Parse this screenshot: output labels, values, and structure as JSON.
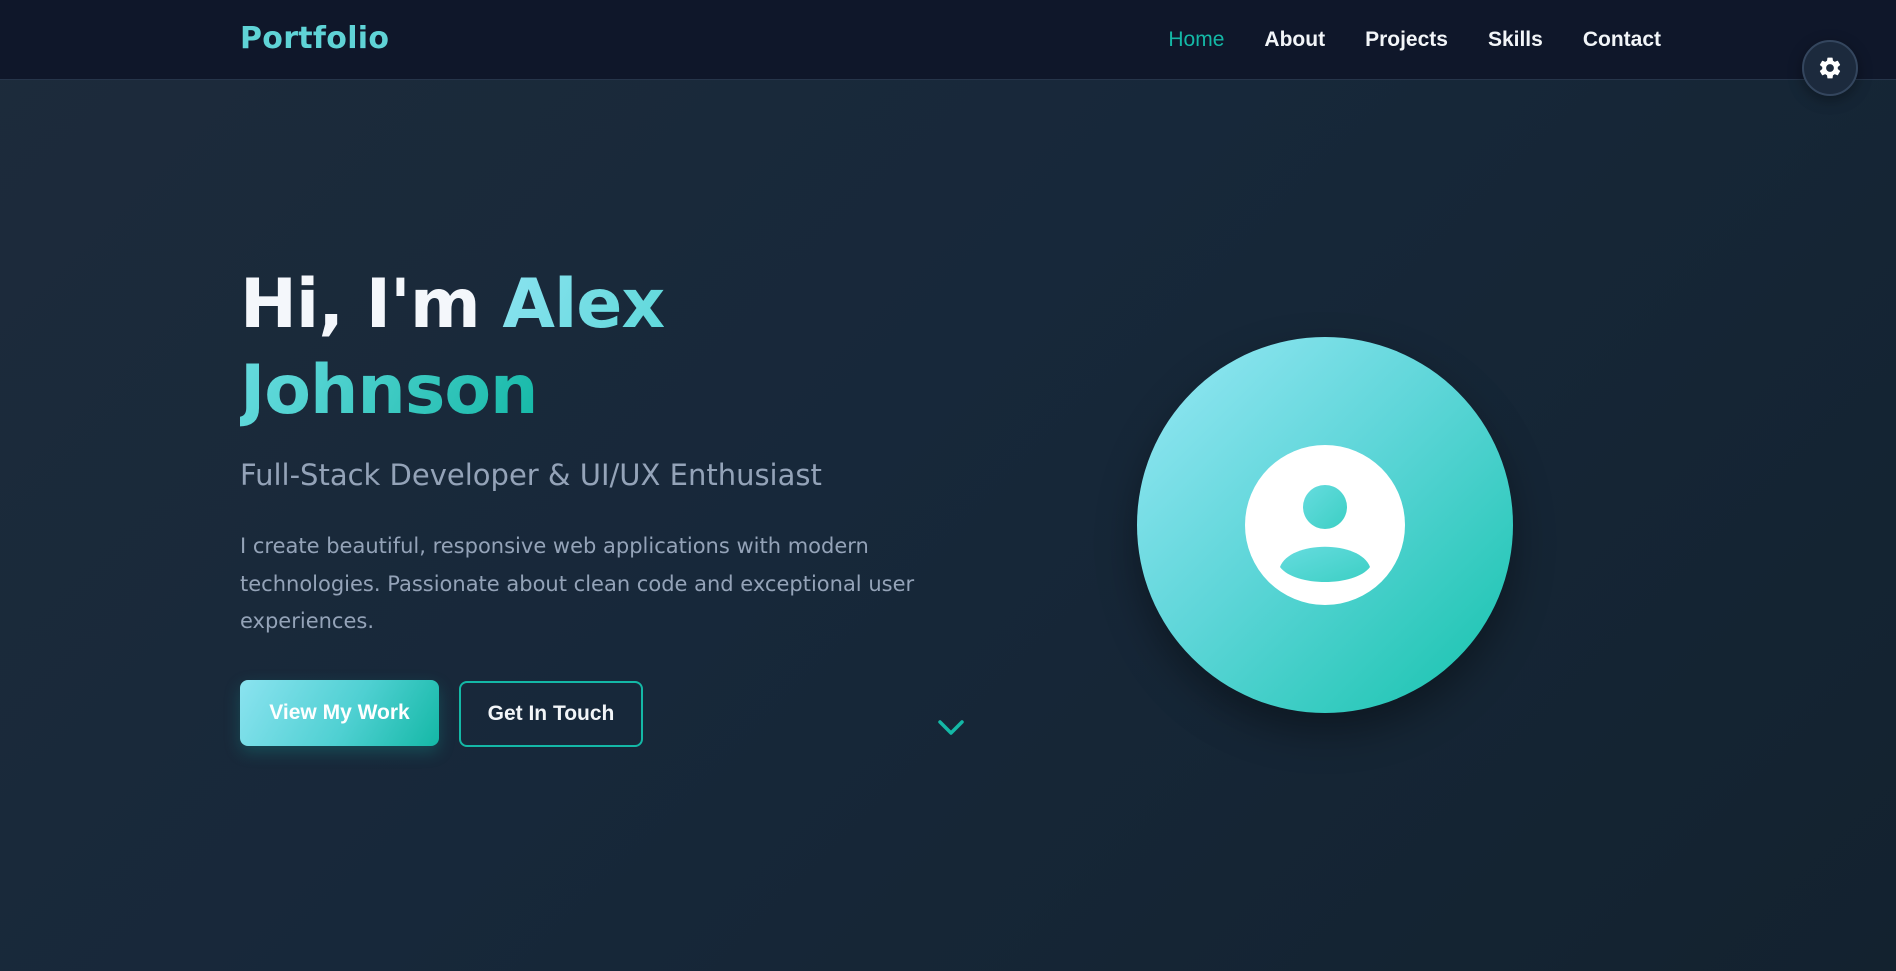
{
  "nav": {
    "logo": "Portfolio",
    "links": [
      {
        "label": "Home",
        "active": true
      },
      {
        "label": "About",
        "active": false
      },
      {
        "label": "Projects",
        "active": false
      },
      {
        "label": "Skills",
        "active": false
      },
      {
        "label": "Contact",
        "active": false
      }
    ]
  },
  "theme_toggle": {
    "icon": "gear-icon"
  },
  "hero": {
    "greeting": "Hi, I'm ",
    "name": "Alex Johnson",
    "subtitle": "Full-Stack Developer & UI/UX Enthusiast",
    "description": "I create beautiful, responsive web applications with modern technologies. Passionate about clean code and exceptional user experiences.",
    "primary_button": "View My Work",
    "secondary_button": "Get In Touch",
    "scroll_icon": "chevron-down-icon",
    "avatar_icon": "user-icon"
  },
  "colors": {
    "accent": "#14b8a6",
    "accent_light": "#8be3f0",
    "nav_background": "#0f172a",
    "page_background": "#1a2a3a",
    "muted_text": "#94a3b8"
  }
}
